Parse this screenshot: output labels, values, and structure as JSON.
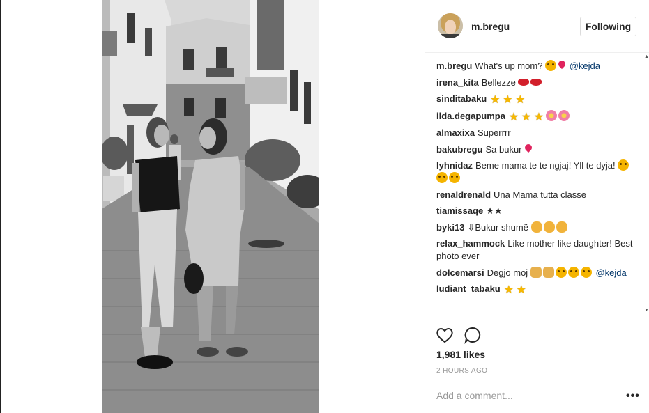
{
  "post": {
    "username": "m.bregu",
    "follow_label": "Following",
    "likes": "1,981 likes",
    "time": "2 HOURS AGO",
    "comment_placeholder": "Add a comment...",
    "more_label": "•••"
  },
  "comments": [
    {
      "user": "m.bregu",
      "text": "What's up mom?",
      "emojis": [
        "face",
        "heart"
      ],
      "mention": "@kejda",
      "after": ""
    },
    {
      "user": "irena_kita",
      "text": "Bellezze",
      "emojis": [
        "lips",
        "lips"
      ]
    },
    {
      "user": "sinditabaku",
      "text": "",
      "emojis": [
        "star",
        "star",
        "star"
      ]
    },
    {
      "user": "ilda.degapumpa",
      "text": "",
      "emojis": [
        "star",
        "star",
        "star",
        "flower",
        "flower"
      ]
    },
    {
      "user": "almaxixa",
      "text": "Superrrr",
      "emojis": []
    },
    {
      "user": "bakubregu",
      "text": "Sa bukur",
      "emojis": [
        "heart"
      ]
    },
    {
      "user": "lyhnidaz",
      "text": "Beme mama te te ngjaj! Yll te dyja!",
      "emojis": [
        "face",
        "face",
        "face"
      ]
    },
    {
      "user": "renaldrenald",
      "text": "Una Mama tutta classe",
      "emojis": []
    },
    {
      "user": "tiamissaqe",
      "text": "★★",
      "emojis": []
    },
    {
      "user": "byki13",
      "text": "⇩Bukur shumë",
      "emojis": [
        "clap",
        "clap",
        "clap"
      ]
    },
    {
      "user": "relax_hammock",
      "text": "Like mother like daughter! Best photo ever",
      "emojis": []
    },
    {
      "user": "dolcemarsi",
      "text": "Degjo moj",
      "mention": "@kejda",
      "emojis": [
        "dance",
        "dance",
        "face",
        "face",
        "face"
      ]
    },
    {
      "user": "ludiant_tabaku",
      "text": "",
      "emojis": [
        "star",
        "star"
      ]
    }
  ],
  "icons": {
    "like": "heart-outline-icon",
    "comment": "speech-bubble-icon",
    "more": "ellipsis-icon"
  }
}
